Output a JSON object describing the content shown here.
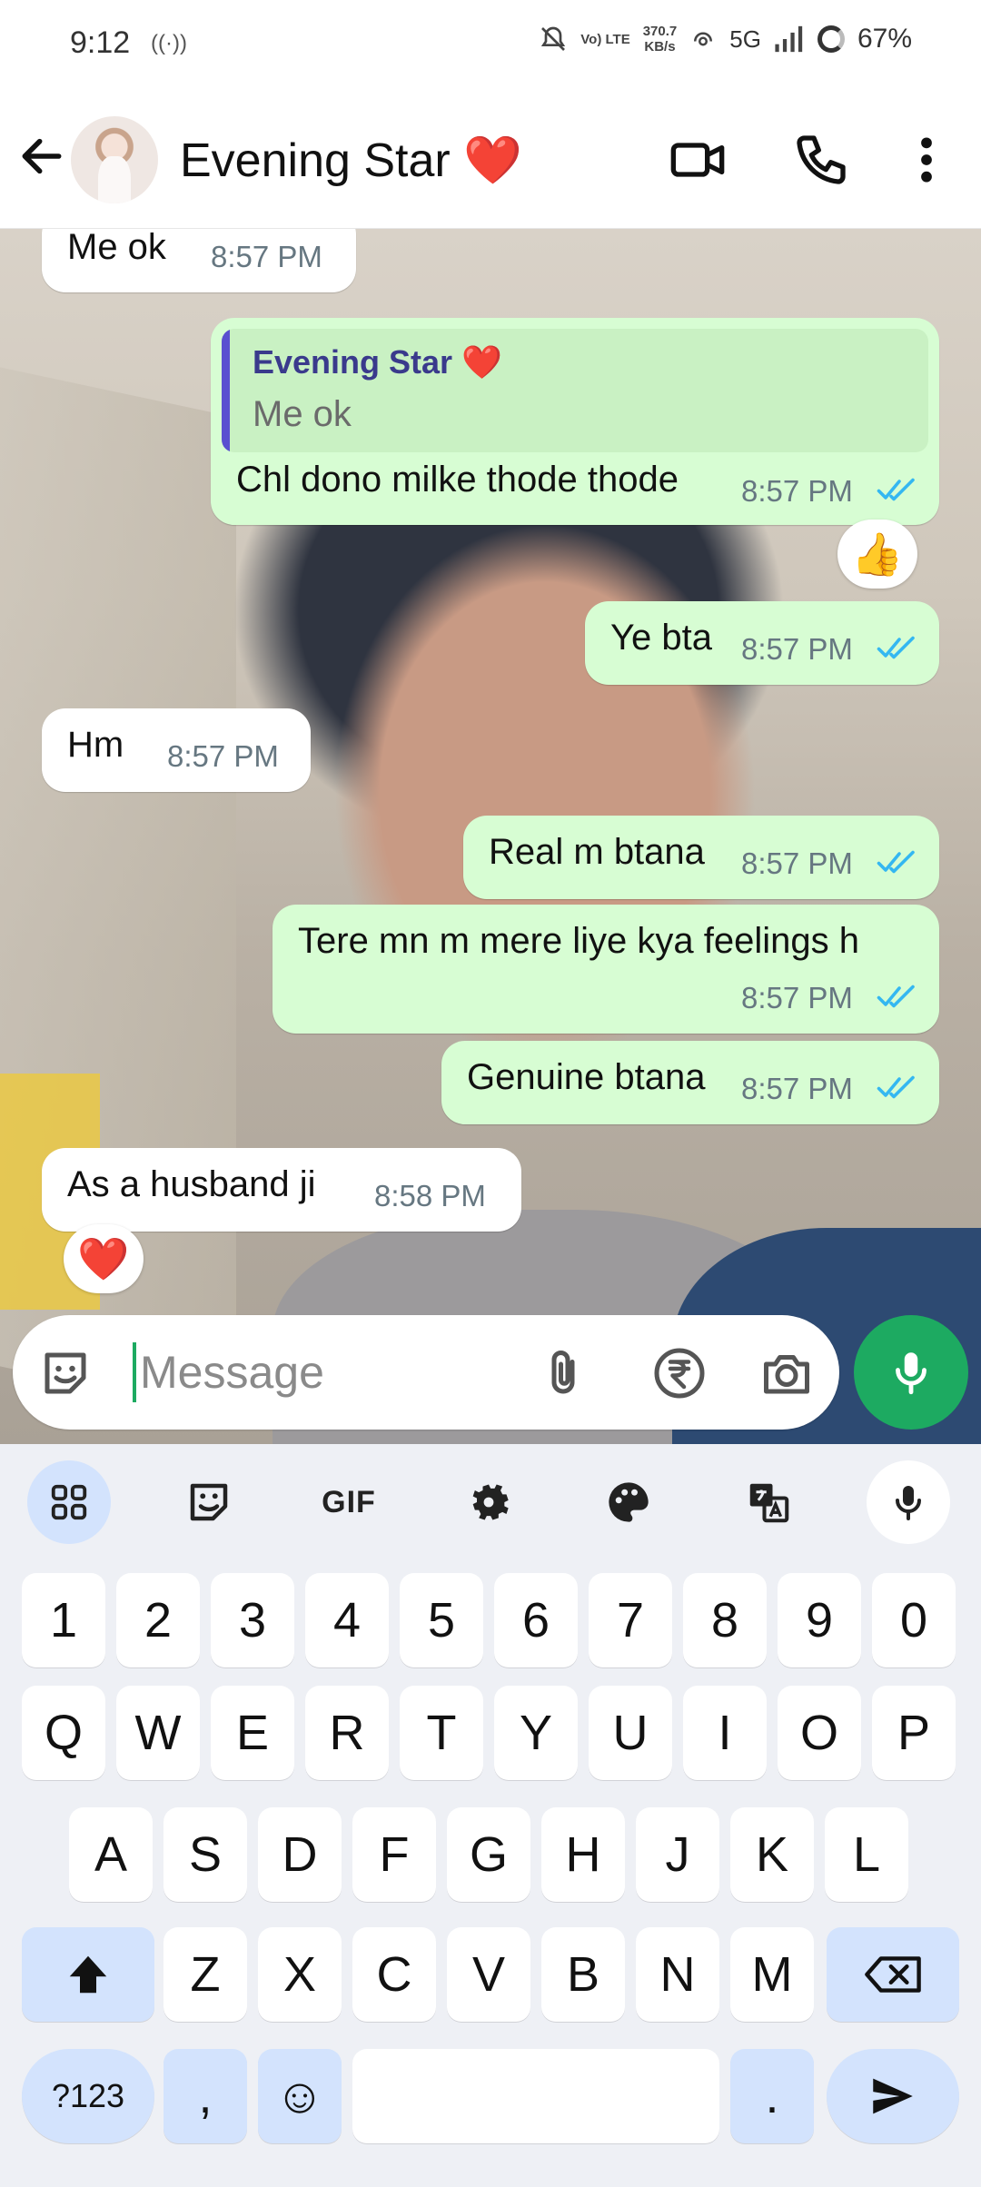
{
  "status_bar": {
    "time": "9:12",
    "signal_text": "((·))",
    "volte": "Vo) LTE",
    "speed": "370.7",
    "speed_unit": "KB/s",
    "network": "5G",
    "battery": "67%"
  },
  "header": {
    "contact_name": "Evening Star ❤️"
  },
  "messages": [
    {
      "dir": "in",
      "text": "Me ok",
      "time": "8:57 PM"
    },
    {
      "dir": "out",
      "quote_name": "Evening Star ❤️",
      "quote_text": "Me ok",
      "text": "Chl dono milke thode thode",
      "time": "8:57 PM",
      "reaction": "👍"
    },
    {
      "dir": "out",
      "text": "Ye bta",
      "time": "8:57 PM"
    },
    {
      "dir": "in",
      "text": "Hm",
      "time": "8:57 PM"
    },
    {
      "dir": "out",
      "text": "Real m btana",
      "time": "8:57 PM"
    },
    {
      "dir": "out",
      "text": "Tere mn m mere liye kya feelings h",
      "time": "8:57 PM"
    },
    {
      "dir": "out",
      "text": "Genuine btana",
      "time": "8:57 PM"
    },
    {
      "dir": "in",
      "text": "As a husband ji",
      "time": "8:58 PM",
      "reaction": "❤️"
    }
  ],
  "composer": {
    "placeholder": "Message"
  },
  "keyboard": {
    "toolbar": {
      "gif": "GIF"
    },
    "row_numbers": [
      "1",
      "2",
      "3",
      "4",
      "5",
      "6",
      "7",
      "8",
      "9",
      "0"
    ],
    "row_q": [
      "Q",
      "W",
      "E",
      "R",
      "T",
      "Y",
      "U",
      "I",
      "O",
      "P"
    ],
    "row_a": [
      "A",
      "S",
      "D",
      "F",
      "G",
      "H",
      "J",
      "K",
      "L"
    ],
    "row_z": [
      "Z",
      "X",
      "C",
      "V",
      "B",
      "N",
      "M"
    ],
    "symbols_key": "?123",
    "comma_key": ",",
    "emoji_key": "☺",
    "period_key": "."
  },
  "colors": {
    "outgoing_bubble": "#d7fdd3",
    "incoming_bubble": "#ffffff",
    "accent_green": "#1daa61",
    "read_ticks": "#34b7f1",
    "quote_bar": "#5a4fd0"
  }
}
